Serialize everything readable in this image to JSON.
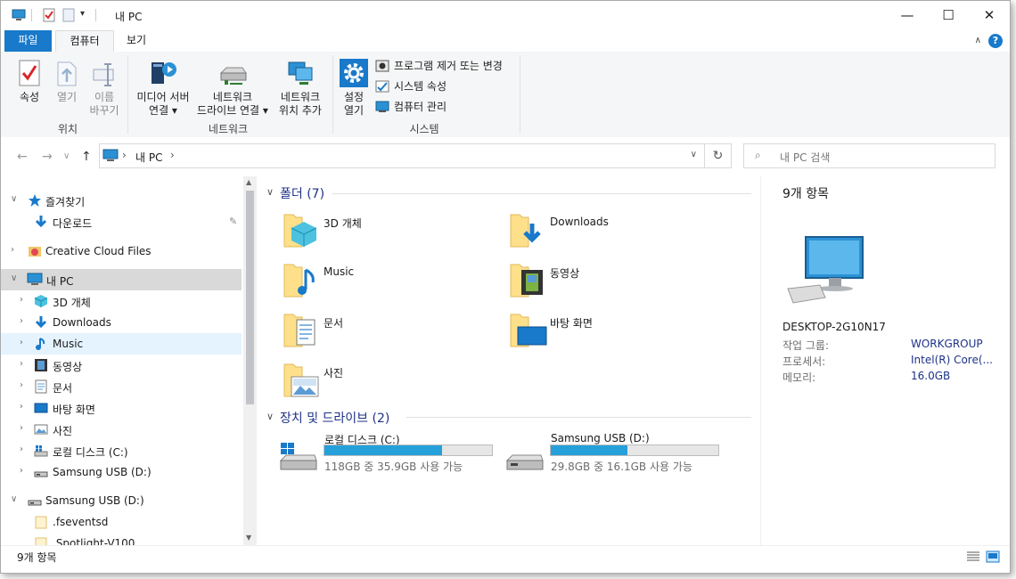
{
  "window": {
    "title": "내 PC",
    "controls": {
      "minimize": "—",
      "maximize": "☐",
      "close": "✕"
    }
  },
  "ribbon": {
    "tabs": [
      "파일",
      "컴퓨터",
      "보기"
    ],
    "groups": {
      "location": {
        "label": "위치",
        "buttons": [
          {
            "line1": "속성",
            "line2": ""
          },
          {
            "line1": "열기",
            "line2": ""
          },
          {
            "line1": "이름",
            "line2": "바꾸기"
          }
        ]
      },
      "network": {
        "label": "네트워크",
        "buttons": [
          {
            "line1": "미디어 서버",
            "line2": "연결 ▾"
          },
          {
            "line1": "네트워크",
            "line2": "드라이브 연결 ▾"
          },
          {
            "line1": "네트워크",
            "line2": "위치 추가"
          }
        ]
      },
      "system": {
        "label": "시스템",
        "settings": {
          "line1": "설정",
          "line2": "열기"
        },
        "items": [
          "프로그램 제거 또는 변경",
          "시스템 속성",
          "컴퓨터 관리"
        ]
      }
    }
  },
  "address": {
    "path": "내 PC",
    "separator": "›",
    "search_placeholder": "내 PC 검색"
  },
  "nav_pane": {
    "items": [
      {
        "label": "즐겨찾기",
        "icon": "star-icon",
        "level": 0,
        "arrow": "∨"
      },
      {
        "label": "다운로드",
        "icon": "download-arrow-icon",
        "level": 1,
        "arrow": ""
      },
      {
        "label": "Creative Cloud Files",
        "icon": "creative-cloud-icon",
        "level": 0,
        "arrow": "›"
      },
      {
        "label": "내 PC",
        "icon": "computer-icon",
        "level": 0,
        "arrow": "∨"
      },
      {
        "label": "3D 개체",
        "icon": "cube-icon",
        "level": 1,
        "arrow": "›"
      },
      {
        "label": "Downloads",
        "icon": "download-arrow-icon",
        "level": 1,
        "arrow": "›"
      },
      {
        "label": "Music",
        "icon": "music-note-icon",
        "level": 1,
        "arrow": "›"
      },
      {
        "label": "동영상",
        "icon": "film-icon",
        "level": 1,
        "arrow": "›"
      },
      {
        "label": "문서",
        "icon": "document-icon",
        "level": 1,
        "arrow": "›"
      },
      {
        "label": "바탕 화면",
        "icon": "desktop-icon",
        "level": 1,
        "arrow": "›"
      },
      {
        "label": "사진",
        "icon": "picture-icon",
        "level": 1,
        "arrow": "›"
      },
      {
        "label": "로컬 디스크 (C:)",
        "icon": "windows-drive-icon",
        "level": 1,
        "arrow": "›"
      },
      {
        "label": "Samsung USB (D:)",
        "icon": "usb-drive-icon",
        "level": 1,
        "arrow": "›"
      },
      {
        "label": "Samsung USB (D:)",
        "icon": "usb-drive-icon",
        "level": 0,
        "arrow": "∨"
      },
      {
        "label": ".fseventsd",
        "icon": "folder-icon",
        "level": 1,
        "arrow": ""
      },
      {
        "label": ".Spotlight-V100",
        "icon": "folder-icon",
        "level": 1,
        "arrow": ""
      }
    ]
  },
  "content": {
    "folders_header": "폴더 (7)",
    "folders": [
      {
        "label": "3D 개체",
        "icon": "cube-folder-icon"
      },
      {
        "label": "Downloads",
        "icon": "download-folder-icon"
      },
      {
        "label": "Music",
        "icon": "music-folder-icon"
      },
      {
        "label": "동영상",
        "icon": "video-folder-icon"
      },
      {
        "label": "문서",
        "icon": "document-folder-icon"
      },
      {
        "label": "바탕 화면",
        "icon": "desktop-folder-icon"
      },
      {
        "label": "사진",
        "icon": "picture-folder-icon"
      }
    ],
    "drives_header": "장치 및 드라이브 (2)",
    "drives": [
      {
        "label": "로컬 디스크 (C:)",
        "detail": "118GB 중 35.9GB 사용 가능",
        "used_fraction": 0.7
      },
      {
        "label": "Samsung USB (D:)",
        "detail": "29.8GB 중 16.1GB 사용 가능",
        "used_fraction": 0.46
      }
    ]
  },
  "details": {
    "count": "9개 항목",
    "name": "DESKTOP-2G10N17",
    "rows": [
      {
        "key": "작업 그룹:",
        "value": "WORKGROUP"
      },
      {
        "key": "프로세서:",
        "value": "Intel(R) Core(..."
      },
      {
        "key": "메모리:",
        "value": "16.0GB"
      }
    ]
  },
  "status": {
    "count": "9개 항목"
  },
  "colors": {
    "accent": "#1979ca",
    "bar_fill": "#26a0da",
    "selection": "#cce8ff",
    "header_text": "#1e3287"
  }
}
